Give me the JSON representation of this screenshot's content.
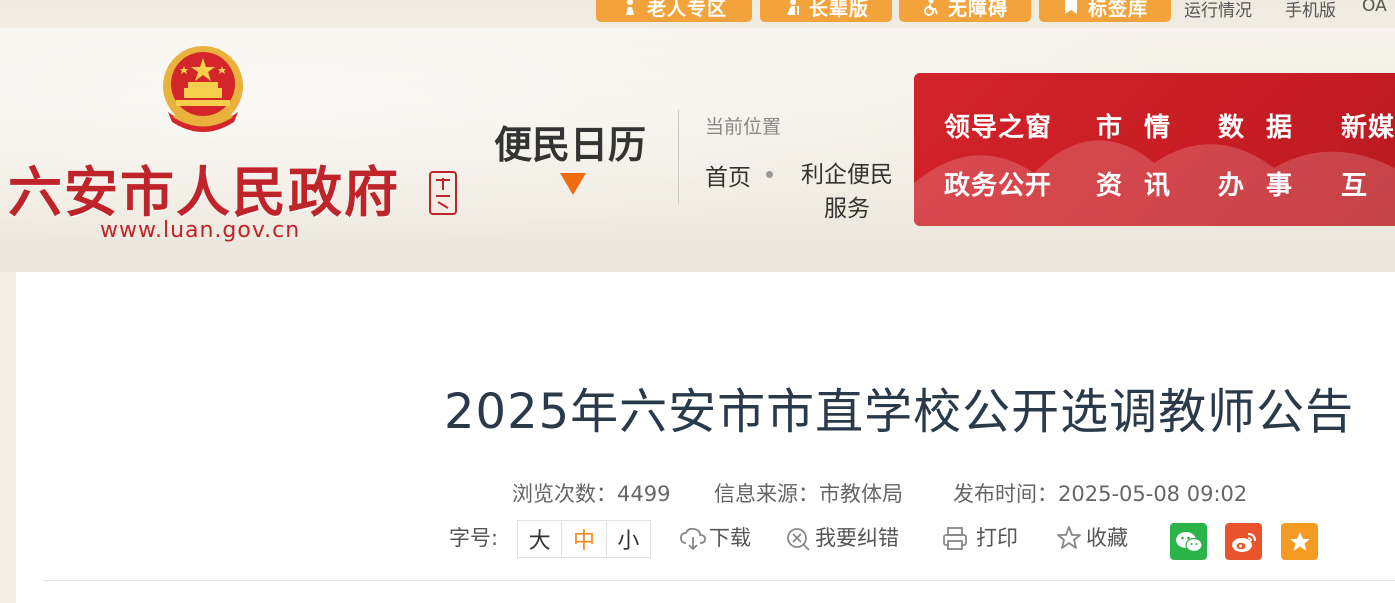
{
  "topbar": {
    "buttons": [
      {
        "label": "老人专区",
        "icon": "elder-icon"
      },
      {
        "label": "长辈版",
        "icon": "elder-mode-icon"
      },
      {
        "label": "无障碍",
        "icon": "accessibility-icon"
      },
      {
        "label": "标签库",
        "icon": "tag-icon"
      }
    ],
    "links": [
      "运行情况",
      "手机版",
      "OA"
    ]
  },
  "header": {
    "site_title": "六安市人民政府",
    "site_url": "www.luan.gov.cn",
    "section_name": "便民日历",
    "breadcrumb_label": "当前位置",
    "breadcrumb_home": "首页",
    "breadcrumb_current": "利企便民服务"
  },
  "nav": {
    "row1": [
      "领导之窗",
      "市情",
      "数据",
      "新媒"
    ],
    "row2": [
      "政务公开",
      "资讯",
      "办事",
      "互"
    ]
  },
  "article": {
    "title": "2025年六安市市直学校公开选调教师公告",
    "views_label": "浏览次数：",
    "views": "4499",
    "source_label": "信息来源：",
    "source": "市教体局",
    "date_label": "发布时间：",
    "date": "2025-05-08 09:02"
  },
  "tools": {
    "font_label": "字号:",
    "font_sizes": [
      "大",
      "中",
      "小"
    ],
    "download": "下载",
    "report": "我要纠错",
    "print": "打印",
    "favorite": "收藏"
  },
  "colors": {
    "brand_red": "#c0242b",
    "accent_orange": "#f2a33c",
    "wechat_green": "#2bb44a",
    "weibo_red": "#e9542c",
    "favorite_orange": "#f59a23"
  }
}
